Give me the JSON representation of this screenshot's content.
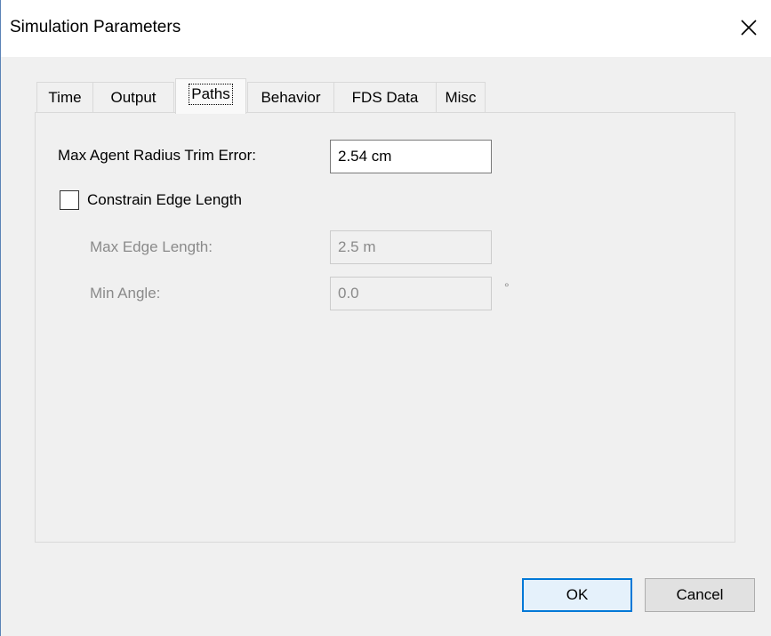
{
  "window": {
    "title": "Simulation Parameters"
  },
  "tabs": [
    {
      "label": "Time",
      "active": false
    },
    {
      "label": "Output",
      "active": false
    },
    {
      "label": "Paths",
      "active": true
    },
    {
      "label": "Behavior",
      "active": false
    },
    {
      "label": "FDS Data",
      "active": false
    },
    {
      "label": "Misc",
      "active": false
    }
  ],
  "paths": {
    "max_agent_radius_trim_error": {
      "label": "Max Agent Radius Trim Error:",
      "value": "2.54 cm"
    },
    "constrain_edge_length": {
      "label": "Constrain Edge Length",
      "checked": false
    },
    "max_edge_length": {
      "label": "Max Edge Length:",
      "value": "2.5 m",
      "enabled": false
    },
    "min_angle": {
      "label": "Min Angle:",
      "value": "0.0",
      "unit": "°",
      "enabled": false
    }
  },
  "buttons": {
    "ok": "OK",
    "cancel": "Cancel"
  },
  "colors": {
    "accent": "#0078d7",
    "window_border": "#5b83b6"
  }
}
